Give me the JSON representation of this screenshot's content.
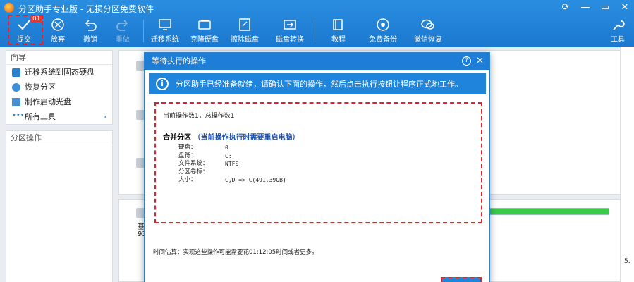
{
  "window": {
    "title": "分区助手专业版 - 无损分区免费软件",
    "controls": [
      "refresh-icon",
      "minimize-icon",
      "maximize-icon",
      "close-icon"
    ]
  },
  "toolbar": {
    "submit": "提交",
    "submit_badge": "01",
    "discard": "放弃",
    "undo": "撤销",
    "redo": "重做",
    "migrate": "迁移系统",
    "clone": "克隆硬盘",
    "wipe": "擦除磁盘",
    "convert": "磁盘转换",
    "tutorial": "教程",
    "backup": "免费备份",
    "wechat": "微信恢复",
    "tools": "工具"
  },
  "left_panel": {
    "wizard_header": "向导",
    "wizard_items": [
      {
        "label": "迁移系统到固态硬盘",
        "icon": "migrate-icon"
      },
      {
        "label": "恢复分区",
        "icon": "recover-icon"
      },
      {
        "label": "制作启动光盘",
        "icon": "disc-icon"
      },
      {
        "label": "所有工具",
        "icon": "dots-icon"
      }
    ],
    "partition_header": "分区操作"
  },
  "disk_panel": {
    "label_partial": "基",
    "size_partial": "93",
    "right_partial": "5."
  },
  "dialog": {
    "title": "等待执行的操作",
    "info": "分区助手已经准备就绪，请确认下面的操作，然后点击执行按钮让程序正式地工作。",
    "count_line": "当前操作数1，总操作数1",
    "operation": {
      "name": "合并分区",
      "note": "（当前操作执行时需要重启电脑）",
      "fields": [
        {
          "key": "硬盘：",
          "value": "0"
        },
        {
          "key": "盘符：",
          "value": "C:"
        },
        {
          "key": "文件系统：",
          "value": "NTFS"
        },
        {
          "key": "分区卷标：",
          "value": ""
        },
        {
          "key": "大小：",
          "value": "C,D => C(491.39GB)"
        }
      ]
    },
    "time_estimate": "时间估算：实现这些操作可能需要花01:12:05时间或者更多。"
  },
  "colors": {
    "toolbar_blue": "#1b78cf",
    "dialog_blue": "#1e7dd6",
    "highlight_red": "#d9262c",
    "progress_green": "#3cc84d"
  }
}
